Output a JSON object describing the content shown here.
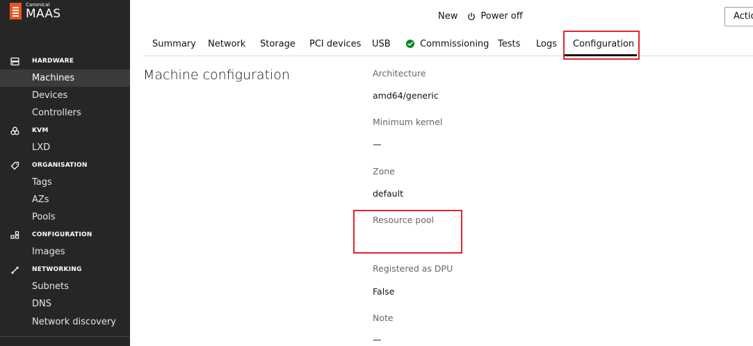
{
  "brand": {
    "canonical": "Canonical",
    "product": "MAAS",
    "accent": "#e95420"
  },
  "sidebar": {
    "sections": [
      {
        "label": "HARDWARE",
        "icon": "server-icon",
        "items": [
          "Machines",
          "Devices",
          "Controllers"
        ]
      },
      {
        "label": "KVM",
        "icon": "kvm-icon",
        "items": [
          "LXD"
        ]
      },
      {
        "label": "ORGANISATION",
        "icon": "tag-icon",
        "items": [
          "Tags",
          "AZs",
          "Pools"
        ]
      },
      {
        "label": "CONFIGURATION",
        "icon": "settings-grid-icon",
        "items": [
          "Images"
        ]
      },
      {
        "label": "NETWORKING",
        "icon": "networking-icon",
        "items": [
          "Subnets",
          "DNS",
          "Network discovery"
        ]
      }
    ],
    "active_item": "Machines"
  },
  "header": {
    "new_label": "New",
    "power_label": "Power off",
    "action_label": "Actio"
  },
  "tabs": [
    {
      "label": "Summary"
    },
    {
      "label": "Network"
    },
    {
      "label": "Storage"
    },
    {
      "label": "PCI devices"
    },
    {
      "label": "USB"
    },
    {
      "label": "Commissioning",
      "status": "success-check-icon"
    },
    {
      "label": "Tests"
    },
    {
      "label": "Logs"
    },
    {
      "label": "Configuration",
      "active": true
    }
  ],
  "main": {
    "title": "Machine configuration",
    "fields": [
      {
        "label": "Architecture",
        "value": "amd64/generic"
      },
      {
        "label": "Minimum kernel",
        "value": "—"
      },
      {
        "label": "Zone",
        "value": "default"
      },
      {
        "label": "Resource pool",
        "value": ""
      },
      {
        "label": "Registered as DPU",
        "value": "False"
      },
      {
        "label": "Note",
        "value": "—"
      }
    ]
  },
  "colors": {
    "sidebar_bg": "#262626",
    "highlight": "#e0262b",
    "success": "#0e8420"
  }
}
